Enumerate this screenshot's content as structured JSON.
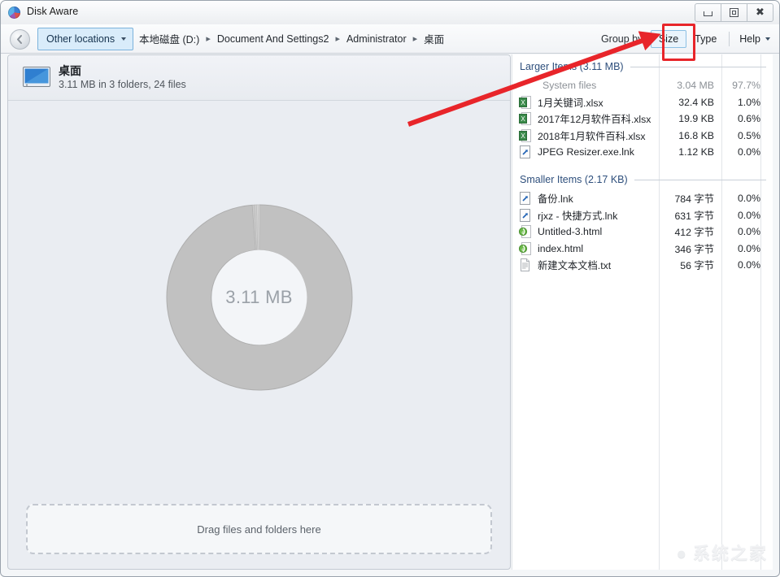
{
  "window": {
    "title": "Disk Aware",
    "app_icon": "pie-chart-icon",
    "controls": {
      "minimize": "minimize-icon",
      "restore": "restore-icon",
      "close": "close-icon"
    }
  },
  "toolbar": {
    "back_label": "‹",
    "other_locations_label": "Other locations",
    "breadcrumbs": [
      "本地磁盘 (D:)",
      "Document And Settings2",
      "Administrator",
      "桌面"
    ],
    "separator": "▸",
    "group_by_label": "Group by:",
    "size_button": "Size",
    "type_button": "Type",
    "help_button": "Help"
  },
  "folder": {
    "name": "桌面",
    "summary": "3.11 MB in 3 folders, 24 files",
    "icon": "desktop-monitor-icon"
  },
  "drop_zone": {
    "label": "Drag files and folders here"
  },
  "chart_data": {
    "type": "pie",
    "title": "3.11 MB",
    "center_label": "3.11 MB",
    "categories": [
      "System files",
      "1月关键词.xlsx",
      "2017年12月软件百科.xlsx",
      "2018年1月软件百科.xlsx",
      "JPEG Resizer.exe.lnk",
      "备份.lnk",
      "rjxz - 快捷方式.lnk",
      "Untitled-3.html",
      "index.html",
      "新建文本文档.txt"
    ],
    "values": [
      97.7,
      1.0,
      0.6,
      0.5,
      0.0,
      0.0,
      0.0,
      0.0,
      0.0,
      0.0
    ],
    "unit": "%",
    "legend": "none",
    "colors": [
      "#bfbfbf",
      "#c6c6c6",
      "#cccccc",
      "#d2d2d2",
      "#d8d8d8"
    ]
  },
  "file_list": {
    "sections": [
      {
        "header": "Larger Items (3.11 MB)",
        "rows": [
          {
            "name": "System files",
            "size": "3.04 MB",
            "percent": "97.7%",
            "icon": "none",
            "dim": true
          },
          {
            "name": "1月关键词.xlsx",
            "size": "32.4 KB",
            "percent": "1.0%",
            "icon": "xlsx-icon",
            "dim": false
          },
          {
            "name": "2017年12月软件百科.xlsx",
            "size": "19.9 KB",
            "percent": "0.6%",
            "icon": "xlsx-icon",
            "dim": false
          },
          {
            "name": "2018年1月软件百科.xlsx",
            "size": "16.8 KB",
            "percent": "0.5%",
            "icon": "xlsx-icon",
            "dim": false
          },
          {
            "name": "JPEG Resizer.exe.lnk",
            "size": "1.12 KB",
            "percent": "0.0%",
            "icon": "shortcut-icon",
            "dim": false
          }
        ]
      },
      {
        "header": "Smaller Items (2.17 KB)",
        "rows": [
          {
            "name": "备份.lnk",
            "size": "784 字节",
            "percent": "0.0%",
            "icon": "shortcut-icon",
            "dim": false
          },
          {
            "name": "rjxz - 快捷方式.lnk",
            "size": "631 字节",
            "percent": "0.0%",
            "icon": "shortcut-icon",
            "dim": false
          },
          {
            "name": "Untitled-3.html",
            "size": "412 字节",
            "percent": "0.0%",
            "icon": "html-icon",
            "dim": false
          },
          {
            "name": "index.html",
            "size": "346 字节",
            "percent": "0.0%",
            "icon": "html-icon",
            "dim": false
          },
          {
            "name": "新建文本文档.txt",
            "size": "56 字节",
            "percent": "0.0%",
            "icon": "txt-icon",
            "dim": false
          }
        ]
      }
    ]
  },
  "annotations": {
    "highlight_target": "Size",
    "arrow_color": "#e8252a",
    "rect_color": "#e8252a"
  },
  "watermark": {
    "text": "系统之家"
  }
}
